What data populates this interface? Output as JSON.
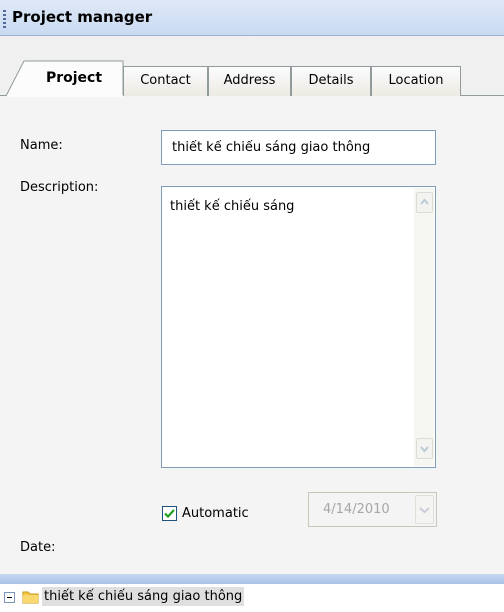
{
  "window": {
    "title": "Project manager"
  },
  "tabs": [
    {
      "label": "Project",
      "active": true
    },
    {
      "label": "Contact",
      "active": false
    },
    {
      "label": "Address",
      "active": false
    },
    {
      "label": "Details",
      "active": false
    },
    {
      "label": "Location",
      "active": false
    }
  ],
  "form": {
    "name_label": "Name:",
    "name_value": "thiết kế chiếu sáng giao thông",
    "description_label": "Description:",
    "description_value": "thiết kế chiếu sáng",
    "date_label": "Date:",
    "automatic_label": "Automatic",
    "automatic_checked": true,
    "date_value": "4/14/2010"
  },
  "tree": {
    "root_label": "thiết kế chiếu sáng giao thông",
    "expanded": true
  },
  "colors": {
    "title_bar": "#c9daf1",
    "panel_bg": "#f4f4f4",
    "input_border": "#7f9db9",
    "checkmark": "#21a121",
    "folder": "#f5c542"
  }
}
